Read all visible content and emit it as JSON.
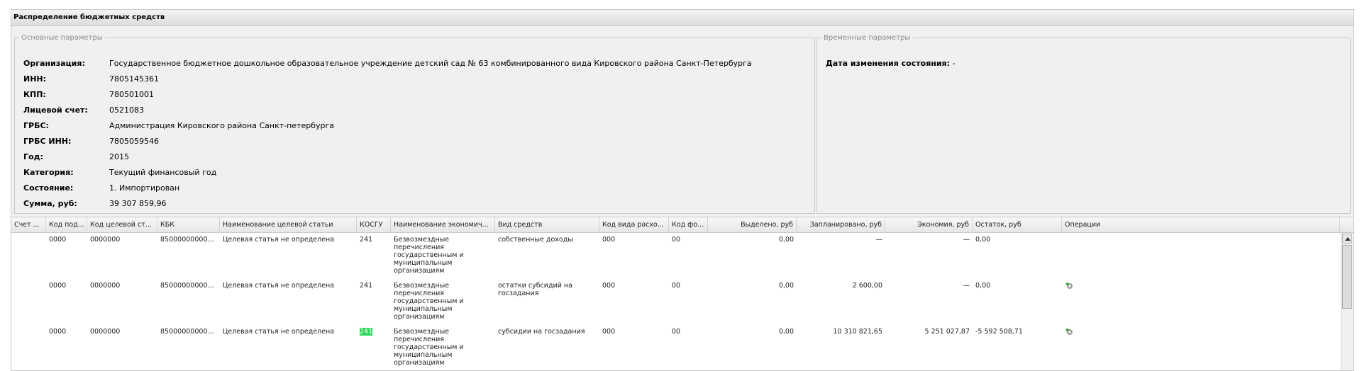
{
  "panel": {
    "title": "Распределение бюджетных средств"
  },
  "main_params": {
    "legend": "Основные параметры",
    "fields": [
      {
        "label": "Организация:",
        "value": "Государственное бюджетное дошкольное образовательное учреждение детский сад № 63 комбинированного вида Кировского района Санкт-Петербурга"
      },
      {
        "label": "ИНН:",
        "value": "7805145361"
      },
      {
        "label": "КПП:",
        "value": "780501001"
      },
      {
        "label": "Лицевой счет:",
        "value": "0521083"
      },
      {
        "label": "ГРБС:",
        "value": "Администрация Кировского района Санкт-петербурга"
      },
      {
        "label": "ГРБС ИНН:",
        "value": "7805059546"
      },
      {
        "label": "Год:",
        "value": "2015"
      },
      {
        "label": "Категория:",
        "value": "Текущий финансовый год"
      },
      {
        "label": "Состояние:",
        "value": "1. Импортирован"
      },
      {
        "label": "Сумма, руб:",
        "value": "39 307 859,96"
      }
    ]
  },
  "time_params": {
    "legend": "Временные параметры",
    "label": "Дата изменения состояния:",
    "value": "-"
  },
  "grid": {
    "columns": [
      "Счет ...",
      "Код под...",
      "Код целевой ст...",
      "КБК",
      "Наименование целевой статьи",
      "КОСГУ",
      "Наименование экономич...",
      "Вид средств",
      "Код вида расхо...",
      "Код фо...",
      "Выделено, руб",
      "Запланировано, руб",
      "Экономия, руб",
      "Остаток, руб",
      "Операции"
    ],
    "rows": [
      {
        "schet": "",
        "kod_pod": "0000",
        "kod_cel": "0000000",
        "kbk": "85000000000...",
        "naim_cel": "Целевая статья не определена",
        "kosgu": "241",
        "kosgu_hl": false,
        "naim_ek": "Безвозмездные перечисления государственным и муниципальным организациям",
        "vid": "собственные доходы",
        "kod_vida": "000",
        "kod_fo": "00",
        "vydeleno": "0,00",
        "zapl": "—",
        "ekon": "—",
        "ostatok": "0,00",
        "op_icon": ""
      },
      {
        "schet": "",
        "kod_pod": "0000",
        "kod_cel": "0000000",
        "kbk": "85000000000...",
        "naim_cel": "Целевая статья не определена",
        "kosgu": "241",
        "kosgu_hl": false,
        "naim_ek": "Безвозмездные перечисления государственным и муниципальным организациям",
        "vid": "остатки субсидий на госзадания",
        "kod_vida": "000",
        "kod_fo": "00",
        "vydeleno": "0,00",
        "zapl": "2 600,00",
        "ekon": "—",
        "ostatok": "0,00",
        "op_icon": "gear-refresh-icon"
      },
      {
        "schet": "",
        "kod_pod": "0000",
        "kod_cel": "0000000",
        "kbk": "85000000000...",
        "naim_cel": "Целевая статья не определена",
        "kosgu": "241",
        "kosgu_hl": true,
        "naim_ek": "Безвозмездные перечисления государственным и муниципальным организациям",
        "vid": "субсидии на госзадания",
        "kod_vida": "000",
        "kod_fo": "00",
        "vydeleno": "0,00",
        "zapl": "10 310 821,65",
        "ekon": "5 251 027,87",
        "ostatok": "-5 592 508,71",
        "op_icon": "gear-refresh-icon"
      }
    ]
  },
  "colors": {
    "highlight": "#2fd45a",
    "header_bg": "#e6e6e6",
    "panel_bg": "#f0f0f0"
  }
}
